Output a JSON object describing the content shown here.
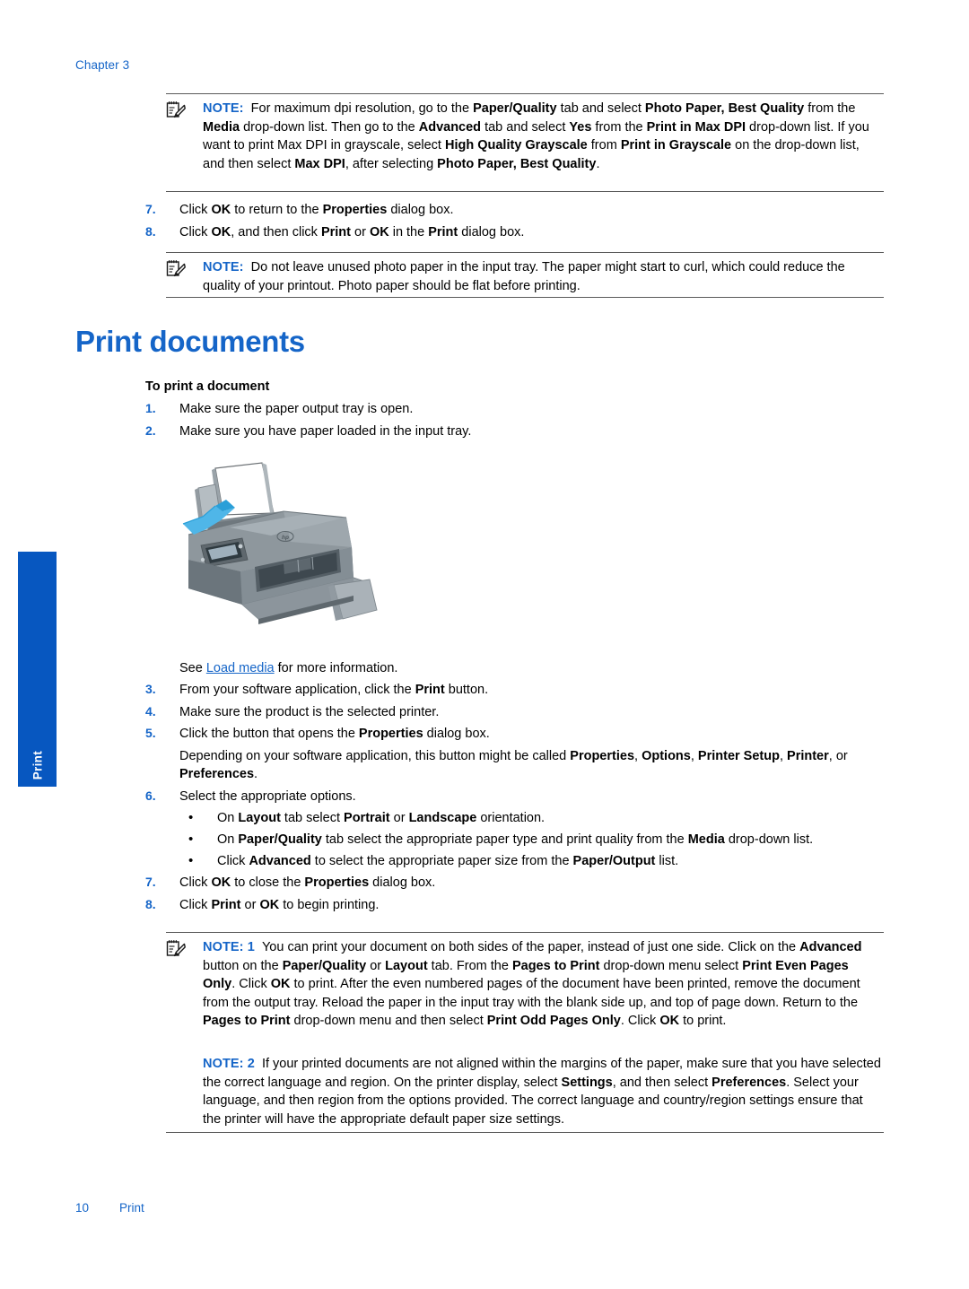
{
  "page": {
    "chapter_label": "Chapter 3",
    "side_tab_label": "Print",
    "footer_page_number": "10",
    "footer_section": "Print",
    "accent_color": "#1565C8",
    "tab_color": "#0757C0"
  },
  "note_top": {
    "icon": "note-pad-icon",
    "keyword": "NOTE:",
    "text_html": "For maximum dpi resolution, go to the <b>Paper/Quality</b> tab and select <b>Photo Paper, Best Quality</b> from the <b>Media</b> drop-down list. Then go to the <b>Advanced</b> tab and select <b>Yes</b> from the <b>Print in Max DPI</b> drop-down list. If you want to print Max DPI in grayscale, select <b>High Quality Grayscale</b> from <b>Print in Grayscale</b> on the drop-down list, and then select <b>Max DPI</b>, after selecting <b>Photo Paper, Best Quality</b>."
  },
  "steps_top": [
    {
      "num": "7.",
      "text_html": "Click <b>OK</b> to return to the <b>Properties</b> dialog box."
    },
    {
      "num": "8.",
      "text_html": "Click <b>OK</b>, and then click <b>Print</b> or <b>OK</b> in the <b>Print</b> dialog box."
    }
  ],
  "note_photo_paper": {
    "icon": "note-pad-icon",
    "keyword": "NOTE:",
    "text_html": "Do not leave unused photo paper in the input tray. The paper might start to curl, which could reduce the quality of your printout. Photo paper should be flat before printing."
  },
  "heading": "Print documents",
  "subheading": "To print a document",
  "steps_1_2": [
    {
      "num": "1.",
      "text_html": "Make sure the paper output tray is open."
    },
    {
      "num": "2.",
      "text_html": "Make sure you have paper loaded in the input tray."
    }
  ],
  "figure": {
    "name": "printer-illustration",
    "alt": "HP all-in-one printer with paper loaded in the input tray and the output tray extended, blue arrow showing paper insertion direction"
  },
  "see_also": {
    "prefix": "See ",
    "link": "Load media",
    "suffix": " for more information."
  },
  "steps_3_8": [
    {
      "num": "3.",
      "text_html": "From your software application, click the <b>Print</b> button."
    },
    {
      "num": "4.",
      "text_html": "Make sure the product is the selected printer."
    },
    {
      "num": "5.",
      "text_html": "Click the button that opens the <b>Properties</b> dialog box."
    }
  ],
  "step5_note_html": "Depending on your software application, this button might be called <b>Properties</b>, <b>Options</b>, <b>Printer Setup</b>, <b>Printer</b>, or <b>Preferences</b>.",
  "step6": {
    "num": "6.",
    "text_html": "Select the appropriate options."
  },
  "step6_bullets": [
    {
      "bullet": "•",
      "text_html": "On <b>Layout</b> tab select <b>Portrait</b> or <b>Landscape</b> orientation."
    },
    {
      "bullet": "•",
      "text_html": "On <b>Paper/Quality</b> tab select the appropriate paper type and print quality from the <b>Media</b> drop-down list."
    },
    {
      "bullet": "•",
      "text_html": "Click <b>Advanced</b> to select the appropriate paper size from the <b>Paper/Output</b> list."
    }
  ],
  "steps_7_8": [
    {
      "num": "7.",
      "text_html": "Click <b>OK</b> to close the <b>Properties</b> dialog box."
    },
    {
      "num": "8.",
      "text_html": "Click <b>Print</b> or <b>OK</b> to begin printing."
    }
  ],
  "note_1": {
    "icon": "note-pad-icon",
    "keyword": "NOTE: 1",
    "text_html": "You can print your document on both sides of the paper, instead of just one side. Click on the <b>Advanced</b> button on the <b>Paper/Quality</b> or <b>Layout</b> tab. From the <b>Pages to Print</b> drop-down menu select <b>Print Even Pages Only</b>. Click <b>OK</b> to print. After the even numbered pages of the document have been printed, remove the document from the output tray. Reload the paper in the input tray with the blank side up, and top of page down. Return to the <b>Pages to Print</b> drop-down menu and then select <b>Print Odd Pages Only</b>. Click <b>OK</b> to print."
  },
  "note_2": {
    "keyword": "NOTE: 2",
    "text_html": "If your printed documents are not aligned within the margins of the paper, make sure that you have selected the correct language and region. On the printer display, select <b>Settings</b>, and then select <b>Preferences</b>. Select your language, and then region from the options provided. The correct language and country/region settings ensure that the printer will have the appropriate default paper size settings."
  }
}
